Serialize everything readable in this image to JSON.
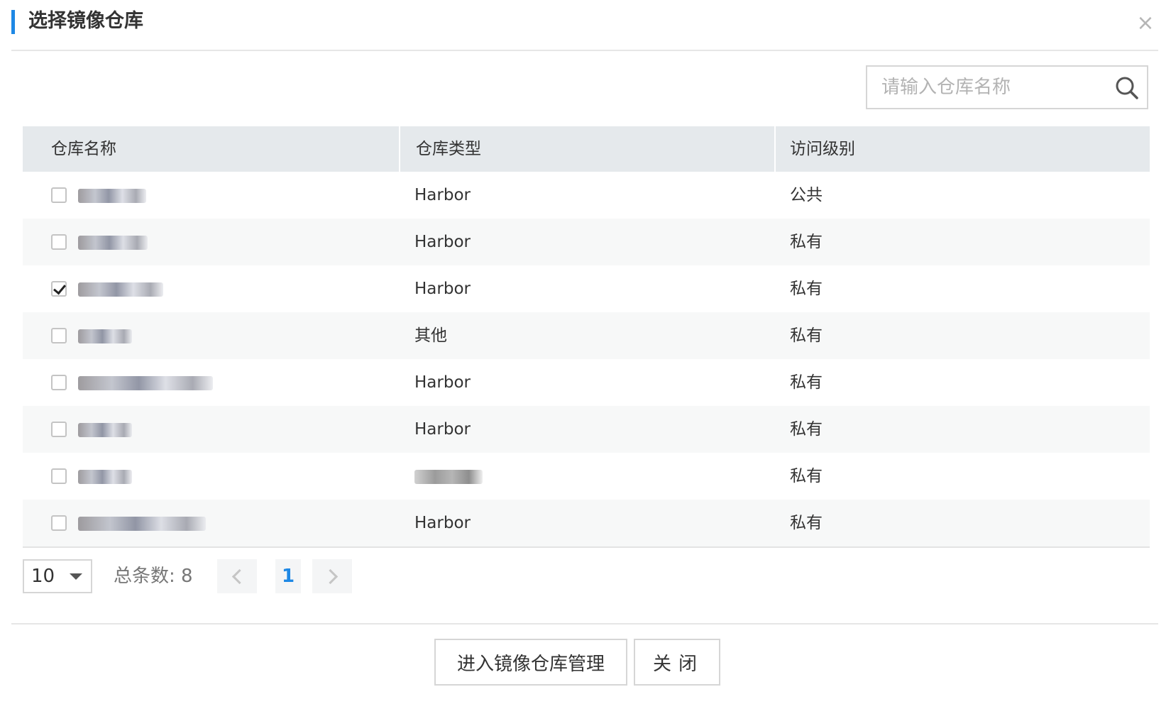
{
  "dialog": {
    "title": "选择镜像仓库",
    "close_symbol": "×"
  },
  "search": {
    "placeholder": "请输入仓库名称",
    "value": ""
  },
  "table": {
    "headers": [
      "仓库名称",
      "仓库类型",
      "访问级别"
    ],
    "rows": [
      {
        "name": "",
        "type": "Harbor",
        "access": "公共",
        "checked": false
      },
      {
        "name": "",
        "type": "Harbor",
        "access": "私有",
        "checked": false
      },
      {
        "name": "",
        "type": "Harbor",
        "access": "私有",
        "checked": true
      },
      {
        "name": "",
        "type": "其他",
        "access": "私有",
        "checked": false
      },
      {
        "name": "",
        "type": "Harbor",
        "access": "私有",
        "checked": false
      },
      {
        "name": "",
        "type": "Harbor",
        "access": "私有",
        "checked": false
      },
      {
        "name": "",
        "type": "",
        "access": "私有",
        "checked": false
      },
      {
        "name": "",
        "type": "Harbor",
        "access": "私有",
        "checked": false
      }
    ]
  },
  "pagination": {
    "page_size": "10",
    "total_label": "总条数: 8",
    "current_page": "1"
  },
  "footer": {
    "manage_label": "进入镜像仓库管理",
    "close_label": "关闭"
  },
  "colors": {
    "accent": "#1e88e5",
    "header_bg": "#e5e9ec"
  },
  "icons": {
    "search": "search-icon",
    "close": "close-icon",
    "caret": "caret-down-icon",
    "prev": "chevron-left-icon",
    "next": "chevron-right-icon"
  }
}
